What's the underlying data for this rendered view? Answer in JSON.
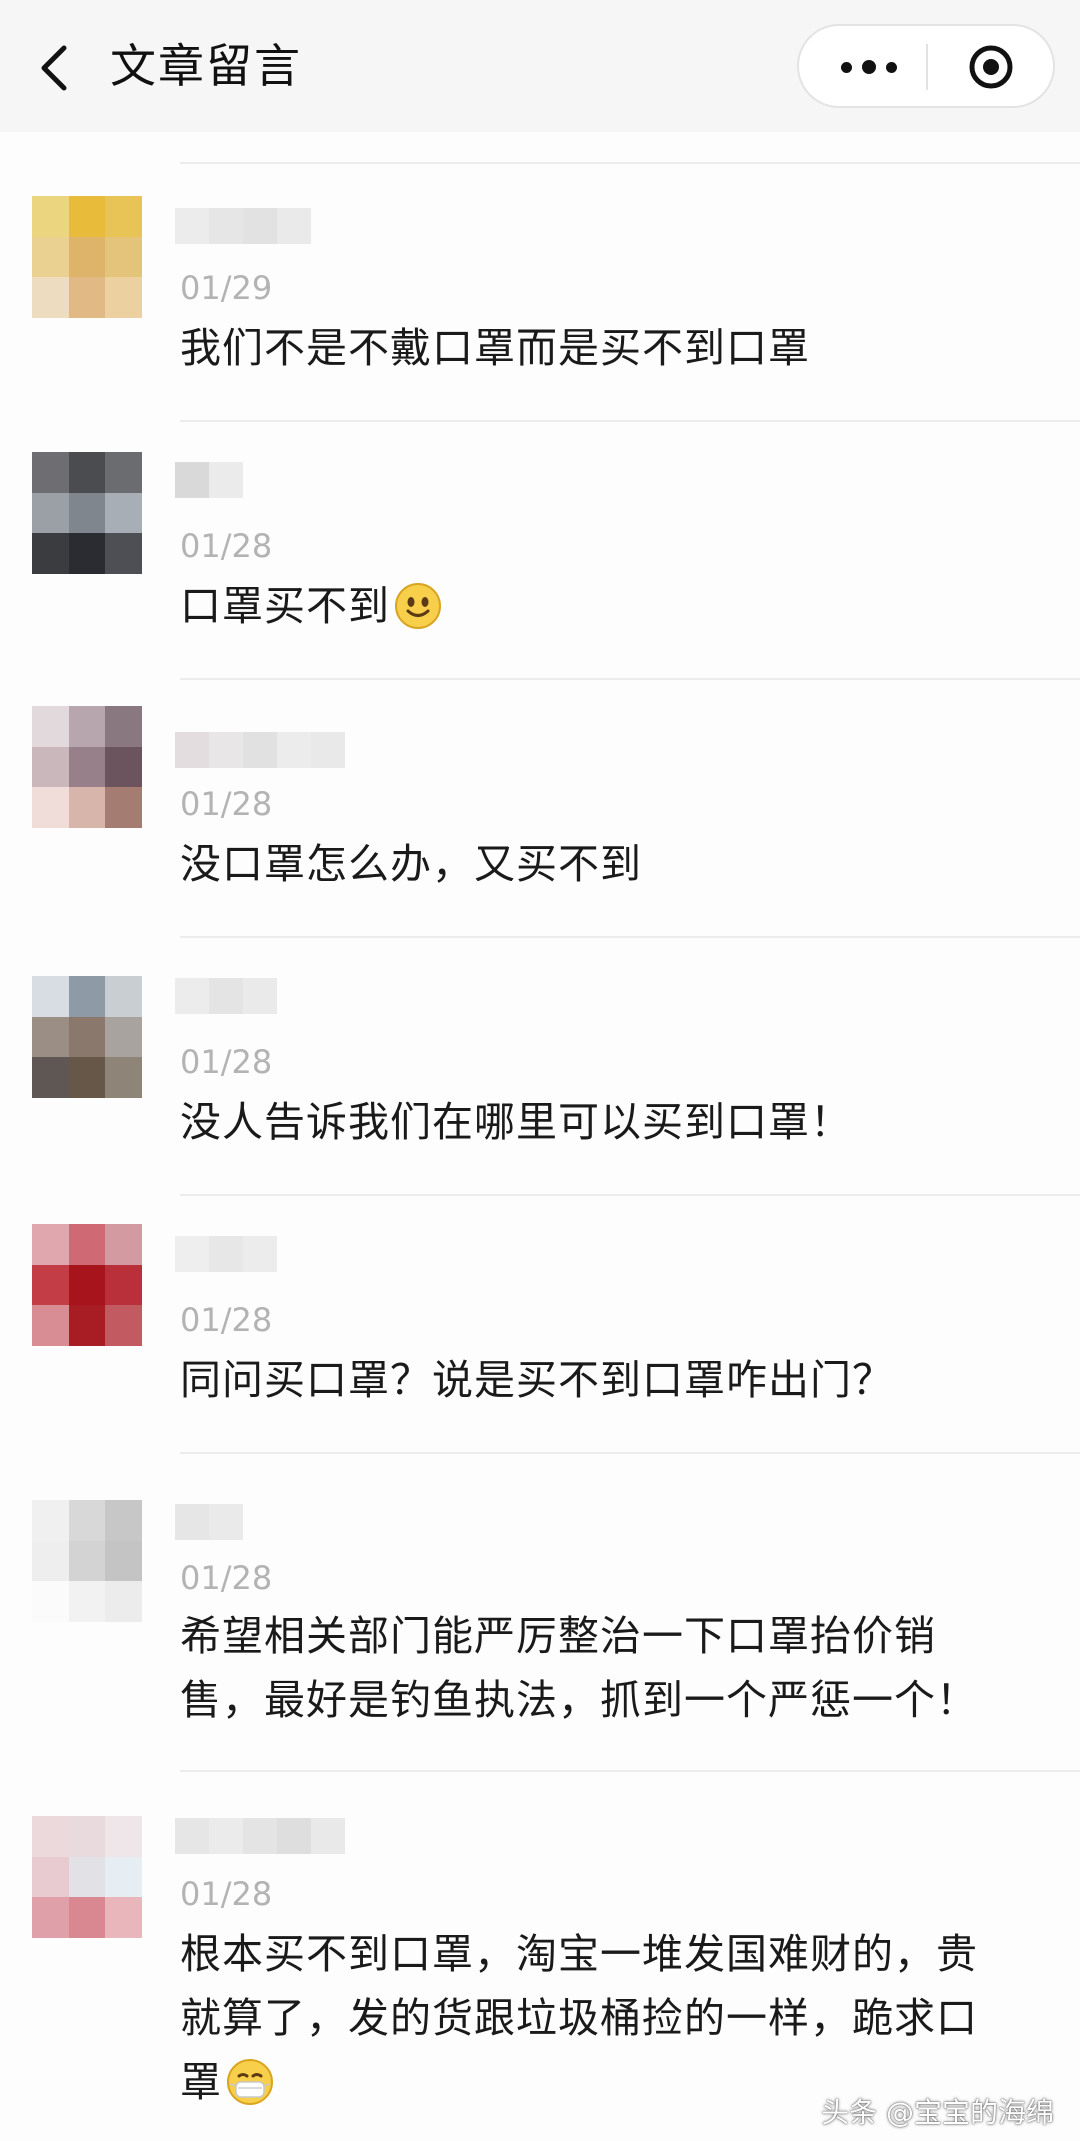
{
  "header": {
    "title": "文章留言"
  },
  "comments": [
    {
      "date": "01/29",
      "text": "我们不是不戴口罩而是买不到口罩",
      "avatar": [
        "#ecd57f",
        "#e9bb3b",
        "#e8c456",
        "#ead192",
        "#ddb46a",
        "#e4c47a",
        "#eedcc0",
        "#e0b985",
        "#ecd0a0"
      ],
      "nick": [
        "#ececec",
        "#e6e6e6",
        "#e2e2e2",
        "#eaeaea"
      ]
    },
    {
      "date": "01/28",
      "text": "口罩买不到",
      "emoji": "slightly-smiling-emoji",
      "avatar": [
        "#6d6d72",
        "#4a4c50",
        "#6b6c70",
        "#9aa0a6",
        "#7f868d",
        "#a7aeb5",
        "#3a3c40",
        "#2a2c31",
        "#4d4f54"
      ],
      "nick": [
        "#d9d9d9",
        "#ebebeb"
      ]
    },
    {
      "date": "01/28",
      "text": "没口罩怎么办，又买不到",
      "avatar": [
        "#e2d9dd",
        "#b7a6ae",
        "#8a7880",
        "#c9b7bb",
        "#97808a",
        "#6b545e",
        "#f0dcd8",
        "#d7b5ab",
        "#a57c72"
      ],
      "nick": [
        "#e4dde0",
        "#e9e6e8",
        "#e1e1e1",
        "#ececec",
        "#e9e9e9"
      ]
    },
    {
      "date": "01/28",
      "text": "没人告诉我们在哪里可以买到口罩！",
      "avatar": [
        "#d7dde3",
        "#8e9aa6",
        "#c9ced3",
        "#9b8e84",
        "#8a786c",
        "#a9a3a0",
        "#5e5753",
        "#675749",
        "#8f8478"
      ],
      "nick": [
        "#ececec",
        "#e4e4e4",
        "#eaeaea"
      ]
    },
    {
      "date": "01/28",
      "text": "同问买口罩？说是买不到口罩咋出门？",
      "avatar": [
        "#e1a7ae",
        "#cf6a74",
        "#d49aa1",
        "#c23d45",
        "#a8141c",
        "#b9303a",
        "#d88c93",
        "#a81d24",
        "#c25a61"
      ],
      "nick": [
        "#eeeeee",
        "#e7e7e7",
        "#ececec"
      ]
    },
    {
      "date": "01/28",
      "text": "希望相关部门能严厉整治一下口罩抬价销售，最好是钓鱼执法，抓到一个严惩一个！",
      "avatar": [
        "#f0f0f0",
        "#d8d8d8",
        "#c7c7c7",
        "#eeeeee",
        "#d3d3d3",
        "#c4c4c4",
        "#fbfbfb",
        "#f2f2f2",
        "#ececec"
      ],
      "nick": [
        "#e6e6e6",
        "#eaeaea"
      ]
    },
    {
      "date": "01/28",
      "text": "根本买不到口罩，淘宝一堆发国难财的，贵就算了，发的货跟垃圾桶捡的一样，跪求口罩",
      "emoji": "mask-emoji",
      "avatar": [
        "#ecd9dc",
        "#e8dadd",
        "#efe6e9",
        "#e8cbd0",
        "#e1e1e6",
        "#e7eef3",
        "#dfa0aa",
        "#d98891",
        "#e9b6bc"
      ],
      "nick": [
        "#e6e6e6",
        "#ebebeb",
        "#e4e4e4",
        "#dedede",
        "#e9e9e9"
      ]
    }
  ],
  "watermark": "头条 @宝宝的海绵"
}
